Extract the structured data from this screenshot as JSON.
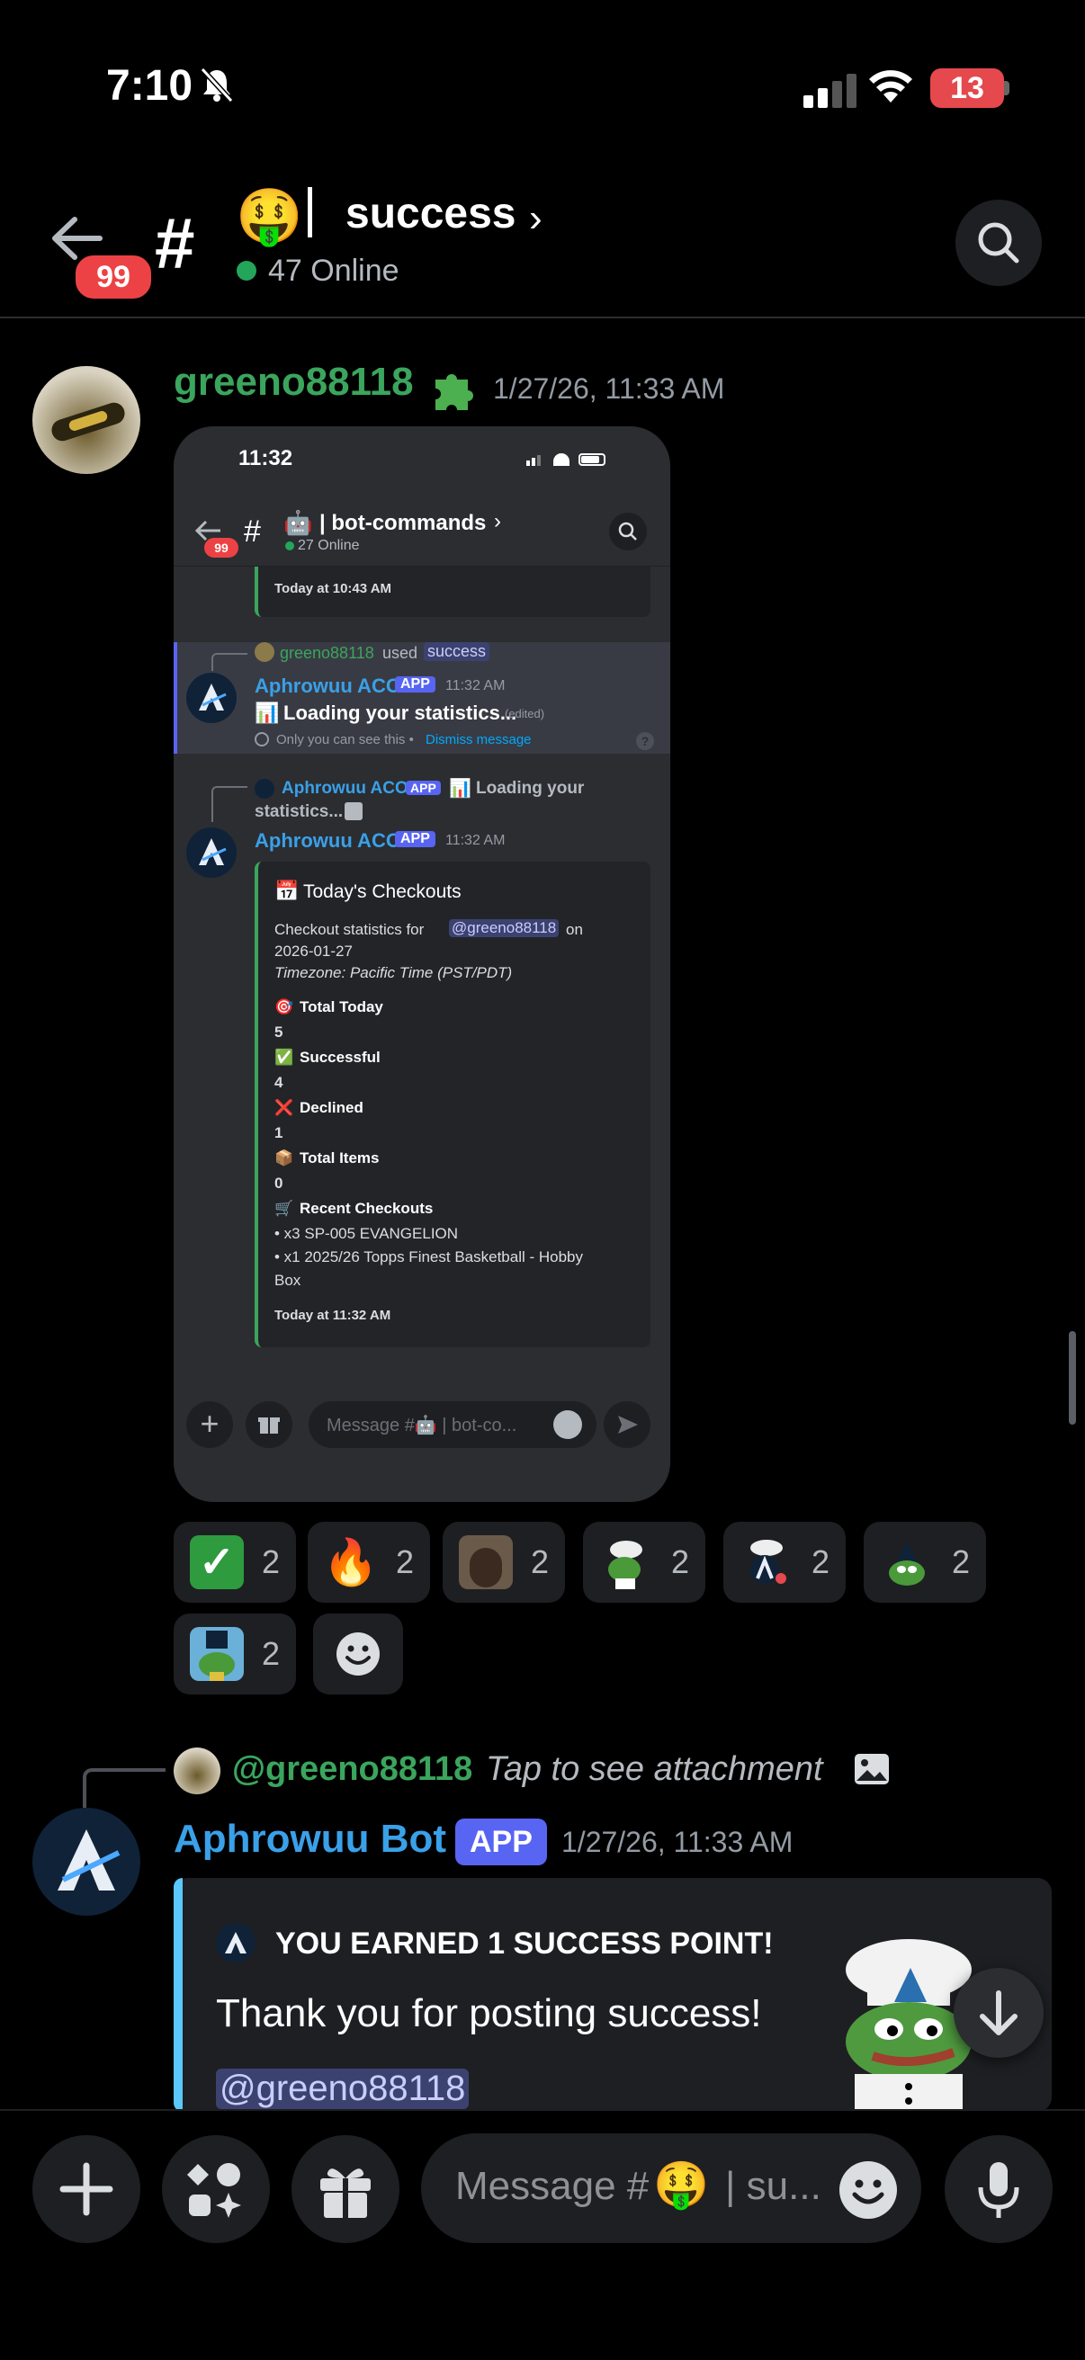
{
  "status_bar": {
    "time": "7:10",
    "battery": "13"
  },
  "header": {
    "notification_count": "99",
    "channel_prefix": "#",
    "channel_emoji": "🤑",
    "channel_separator": "|",
    "channel_name": "success",
    "chevron": "›",
    "online_text": "47 Online",
    "colors": {
      "online": "#23a55a",
      "badge": "#ed4245"
    }
  },
  "message1": {
    "author": "greeno88118",
    "author_color": "#3ba55d",
    "author_badge_icon": "puzzle-piece-icon",
    "timestamp": "1/27/26, 11:33 AM",
    "attachment": {
      "status_time": "11:32",
      "badge": "99",
      "channel_emoji": "🤖",
      "channel_name": "| bot-commands",
      "chevron": "›",
      "online": "27 Online",
      "prev_time": "Today at 10:43 AM",
      "used_user": "greeno88118",
      "used_word": "used",
      "used_command": "success",
      "bot_name": "Aphrowuu ACO",
      "app_tag": "APP",
      "msg1_time": "11:32 AM",
      "msg1_text": "Loading your statistics...",
      "msg1_edited": "(edited)",
      "msg1_only": "Only you can see this •",
      "msg1_dismiss": "Dismiss message",
      "reply_bot": "Aphrowuu ACO",
      "reply_app": "APP",
      "reply_text_1": "Loading your",
      "reply_text_2": "statistics...",
      "msg2_time": "11:32 AM",
      "embed_title": "Today's Checkouts",
      "embed_desc_1": "Checkout statistics for",
      "embed_mention": "@greeno88118",
      "embed_desc_2": "on",
      "embed_date": "2026-01-27",
      "embed_tz": "Timezone: Pacific Time (PST/PDT)",
      "fields": [
        {
          "icon": "🎯",
          "label": "Total Today",
          "value": "5"
        },
        {
          "icon": "✅",
          "label": "Successful",
          "value": "4"
        },
        {
          "icon": "❌",
          "label": "Declined",
          "value": "1"
        },
        {
          "icon": "📦",
          "label": "Total Items",
          "value": "0"
        }
      ],
      "recent_icon": "🛒",
      "recent_label": "Recent Checkouts",
      "recent_1": "• x3 SP-005 EVANGELION",
      "recent_2": "• x1 2025/26 Topps Finest Basketball - Hobby",
      "recent_3": "Box",
      "embed_footer": "Today at 11:32 AM",
      "composer_placeholder": "Message #🤖 | bot-co..."
    },
    "reactions": [
      {
        "emoji": "✅",
        "count": "2"
      },
      {
        "emoji": "🔥",
        "count": "2"
      },
      {
        "emoji": "face-emoji",
        "count": "2"
      },
      {
        "emoji": "pepe-chef-emoji",
        "count": "2"
      },
      {
        "emoji": "aphrowuu-chef-emoji",
        "count": "2"
      },
      {
        "emoji": "pepe-logo-emoji",
        "count": "2"
      },
      {
        "emoji": "pepe-sign-emoji",
        "count": "2"
      }
    ]
  },
  "message2": {
    "reply_user": "@greeno88118",
    "reply_text": "Tap to see attachment",
    "author": "Aphrowuu Bot",
    "app_tag": "APP",
    "timestamp": "1/27/26, 11:33 AM",
    "embed_author": "YOU EARNED 1 SUCCESS POINT!",
    "embed_text": "Thank you for posting success!",
    "embed_mention": "@greeno88118",
    "author_color": "#3aa0e8"
  },
  "composer": {
    "placeholder_1": "Message #",
    "placeholder_emoji": "🤑",
    "placeholder_2": "| su..."
  }
}
